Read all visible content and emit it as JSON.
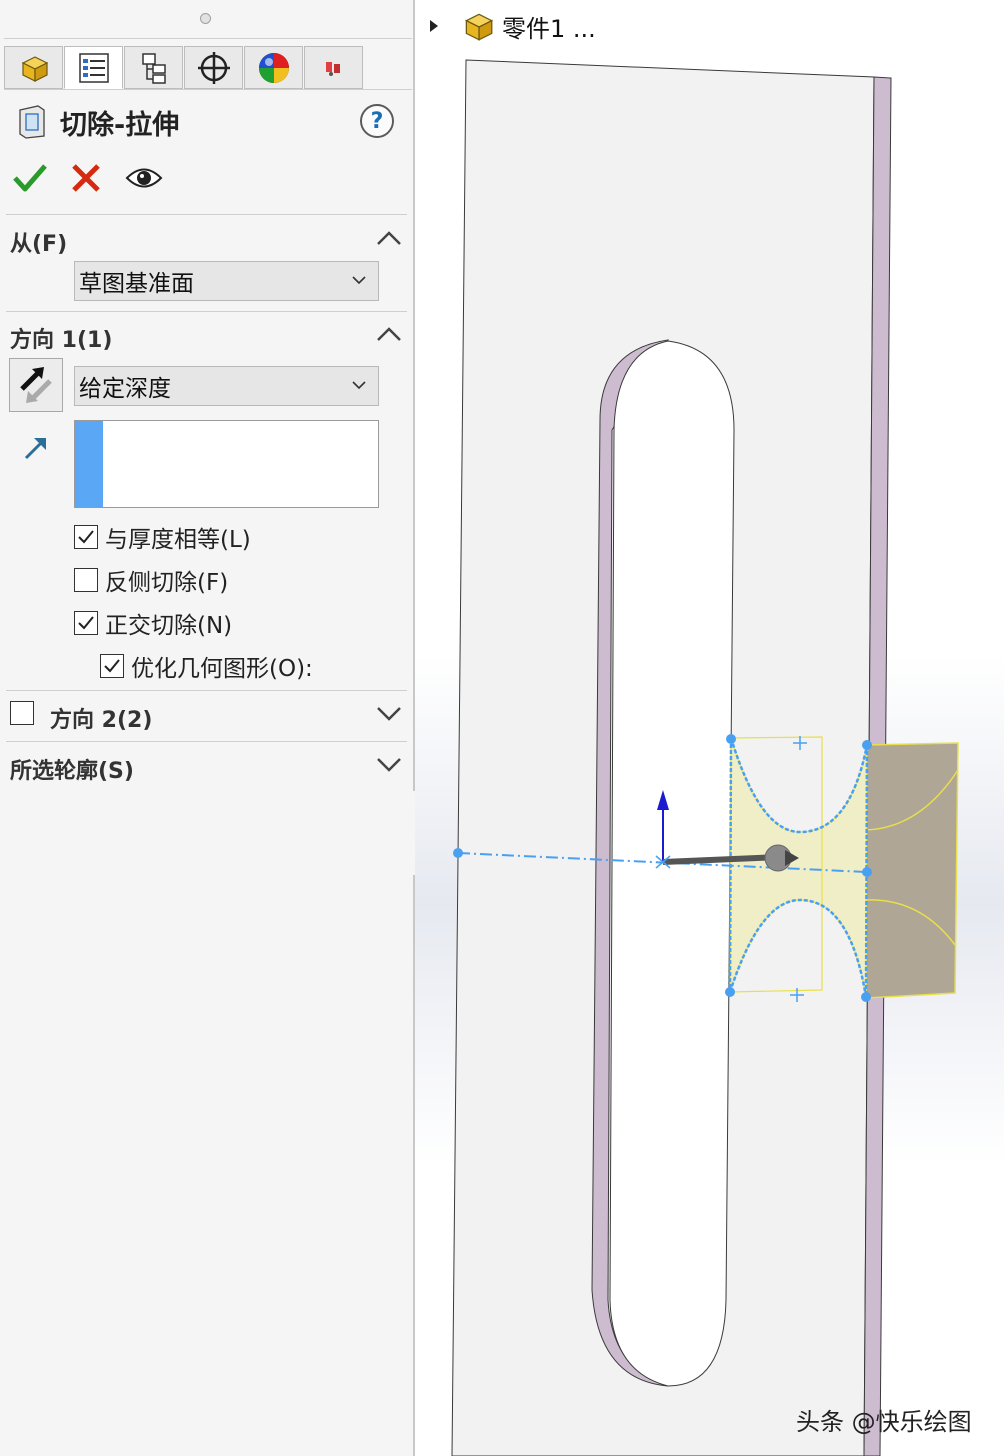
{
  "feature": {
    "title": "切除-拉伸",
    "help_label": "?"
  },
  "tabs": [
    {
      "name": "feature-manager-icon"
    },
    {
      "name": "property-manager-icon"
    },
    {
      "name": "configuration-manager-icon"
    },
    {
      "name": "dimxpert-manager-icon"
    },
    {
      "name": "display-manager-icon"
    },
    {
      "name": "cam-manager-icon"
    }
  ],
  "actions": {
    "ok": "check-icon",
    "cancel": "x-icon",
    "preview": "eye-icon"
  },
  "from_section": {
    "title": "从(F)",
    "selected": "草图基准面"
  },
  "direction1": {
    "title": "方向 1(1)",
    "end_condition": "给定深度",
    "options": [
      {
        "label": "与厚度相等(L)",
        "checked": true
      },
      {
        "label": "反侧切除(F)",
        "checked": false
      },
      {
        "label": "正交切除(N)",
        "checked": true
      },
      {
        "label": "优化几何图形(O):",
        "checked": true
      }
    ]
  },
  "direction2": {
    "title": "方向 2(2)",
    "checked": false
  },
  "contours": {
    "title": "所选轮廓(S)"
  },
  "tree": {
    "part_name": "零件1 ..."
  },
  "watermark": "头条 @快乐绘图",
  "colors": {
    "accent_blue": "#5aa8f5",
    "ok_green": "#2a9a2a",
    "cancel_red": "#d42a10",
    "plate_edge": "#cdbcd0",
    "extrude_face": "#b0a696"
  }
}
